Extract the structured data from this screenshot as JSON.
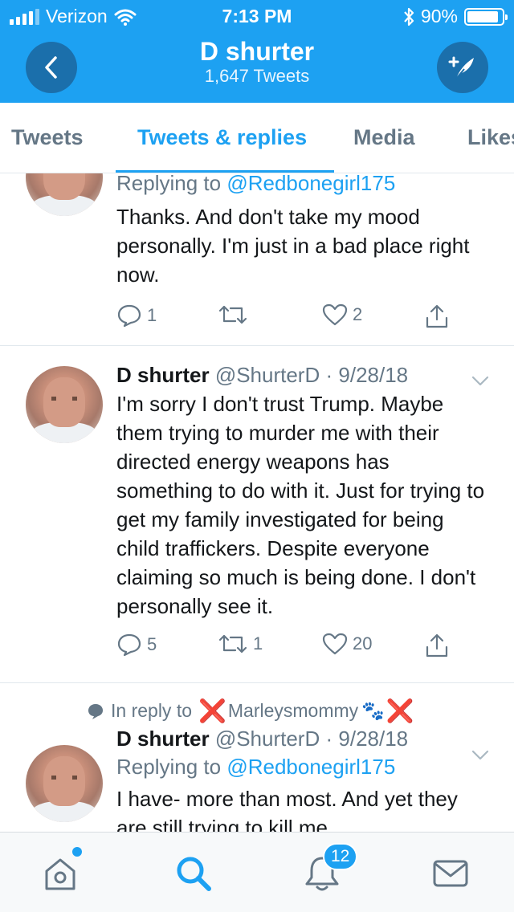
{
  "status_bar": {
    "carrier": "Verizon",
    "time": "7:13 PM",
    "battery": "90%",
    "battery_level": 0.9,
    "icons": [
      "signal-bars-icon",
      "wifi-icon",
      "bluetooth-icon",
      "battery-icon"
    ]
  },
  "header": {
    "title": "D shurter",
    "subtitle": "1,647 Tweets",
    "accent_color": "#1da1f2"
  },
  "tabs": [
    {
      "label": "Tweets",
      "active": false
    },
    {
      "label": "Tweets & replies",
      "active": true
    },
    {
      "label": "Media",
      "active": false
    },
    {
      "label": "Likes",
      "active": false
    }
  ],
  "tweets": [
    {
      "replying_prefix": "Replying to",
      "replying_to": "@Redbonegirl175",
      "text": "Thanks. And don't take my mood personally. I'm just in a bad place right now.",
      "replies": "1",
      "retweets": "",
      "likes": "2"
    },
    {
      "name": "D shurter",
      "handle": "@ShurterD",
      "dot": "·",
      "date": "9/28/18",
      "text": "I'm sorry I don't trust Trump. Maybe them trying to murder me with their directed energy weapons has something to do with it. Just for trying to get my family investigated for being child traffickers. Despite everyone claiming so much is being done. I don't personally see it.",
      "replies": "5",
      "retweets": "1",
      "likes": "20"
    },
    {
      "context_prefix": "In reply to",
      "context_user": "Marleysmommy",
      "context_emoji": "🐾",
      "context_mark": "❌",
      "name": "D shurter",
      "handle": "@ShurterD",
      "dot": "·",
      "date": "9/28/18",
      "replying_prefix": "Replying to",
      "replying_to": "@Redbonegirl175",
      "text": "I have- more than most. And yet they are still trying to kill me."
    }
  ],
  "bottom_nav": {
    "items": [
      "home-icon",
      "search-icon",
      "notifications-icon",
      "messages-icon"
    ],
    "notifications_count": "12"
  }
}
